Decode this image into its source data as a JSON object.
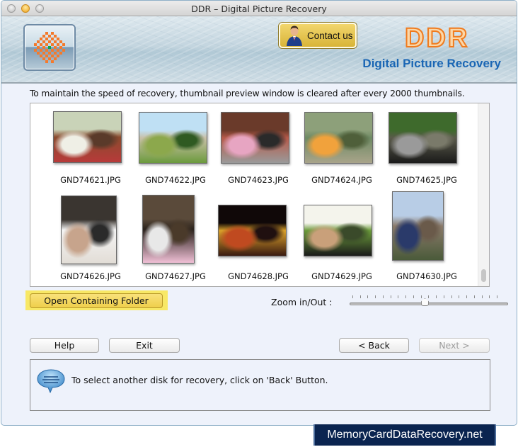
{
  "window": {
    "title": "DDR – Digital Picture Recovery"
  },
  "header": {
    "logo_icon": "checker-burst-icon",
    "contact_button_label": "Contact us",
    "contact_icon": "person-icon",
    "brand_name": "DDR",
    "brand_subtitle": "Digital Picture Recovery",
    "brand_color": "#f07b1e",
    "subtitle_color": "#1a66b4"
  },
  "main": {
    "info_text": "To maintain the speed of recovery, thumbnail preview window is cleared after every 2000 thumbnails.",
    "thumbnails": [
      {
        "name": "GND74621.JPG",
        "orientation": "landscape",
        "scene": "girl-in-room"
      },
      {
        "name": "GND74622.JPG",
        "orientation": "landscape",
        "scene": "house-lawn"
      },
      {
        "name": "GND74623.JPG",
        "orientation": "landscape",
        "scene": "kids-playground"
      },
      {
        "name": "GND74624.JPG",
        "orientation": "landscape",
        "scene": "river-rafting"
      },
      {
        "name": "GND74625.JPG",
        "orientation": "landscape",
        "scene": "tunnel-road"
      },
      {
        "name": "GND74626.JPG",
        "orientation": "portrait",
        "scene": "baby"
      },
      {
        "name": "GND74627.JPG",
        "orientation": "portrait",
        "scene": "girl-with-dog"
      },
      {
        "name": "GND74628.JPG",
        "orientation": "landscape",
        "scene": "night-arches"
      },
      {
        "name": "GND74629.JPG",
        "orientation": "landscape",
        "scene": "group-photo"
      },
      {
        "name": "GND74630.JPG",
        "orientation": "portrait",
        "scene": "group-outdoors"
      }
    ],
    "open_folder_label": "Open Containing Folder",
    "zoom_label": "Zoom in/Out :",
    "zoom_value_fraction": 0.5,
    "zoom_tick_count": 20
  },
  "buttons": {
    "help": "Help",
    "exit": "Exit",
    "back": "< Back",
    "next": "Next >"
  },
  "status": {
    "icon": "speech-bubble-icon",
    "message": "To select another disk for recovery, click on 'Back' Button."
  },
  "watermark": "MemoryCardDataRecovery.net"
}
